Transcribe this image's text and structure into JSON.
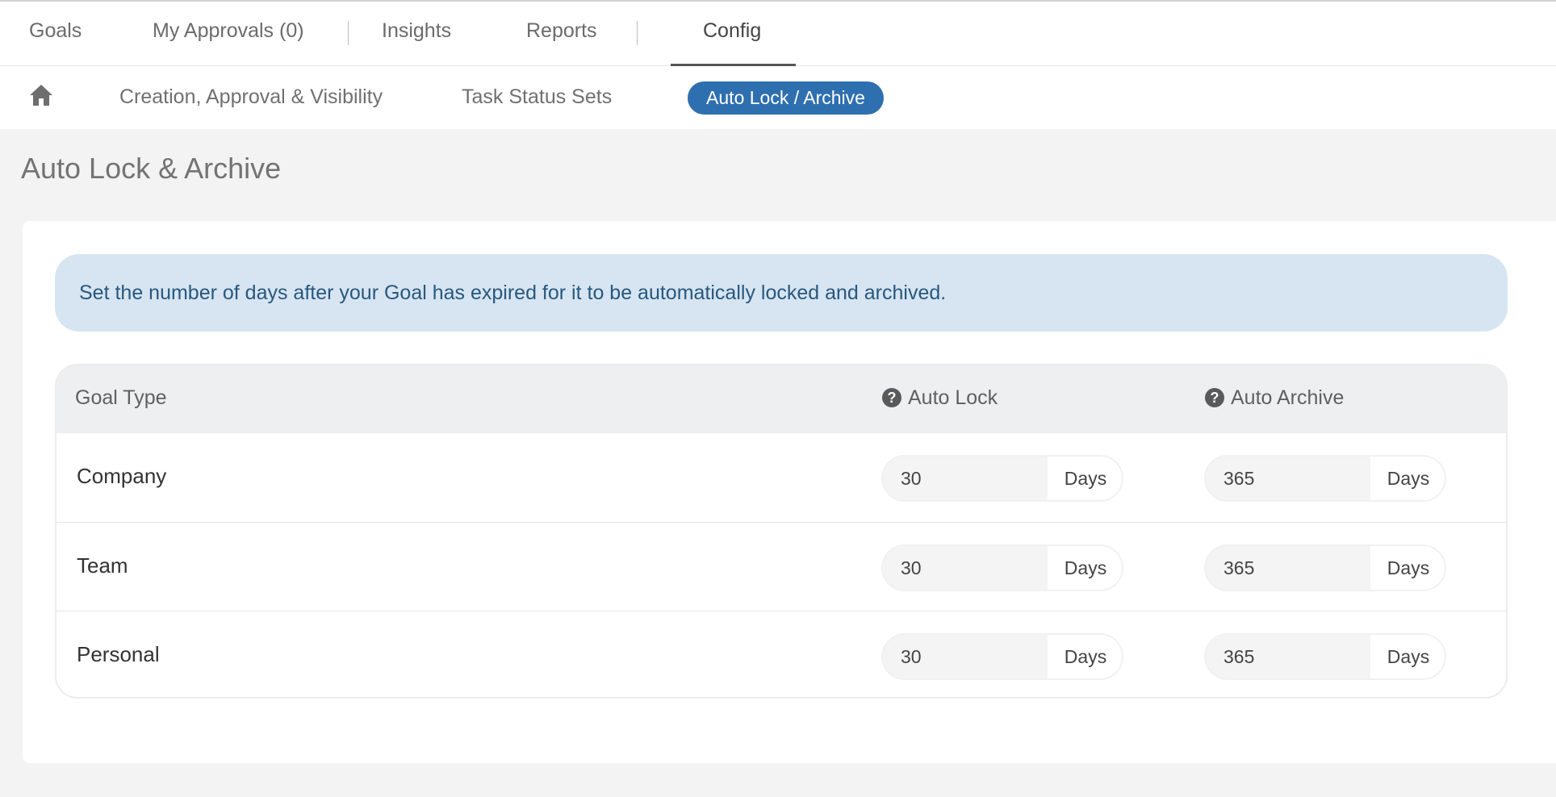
{
  "top_tabs": [
    {
      "label": "Goals"
    },
    {
      "label": "My Approvals (0)"
    },
    {
      "label": "Insights"
    },
    {
      "label": "Reports"
    },
    {
      "label": "Config"
    }
  ],
  "active_top_tab": "Config",
  "sub_nav": {
    "home_icon": "home-icon",
    "links": [
      {
        "label": "Creation, Approval & Visibility"
      },
      {
        "label": "Task Status Sets"
      }
    ],
    "active_pill": "Auto Lock / Archive"
  },
  "page_title": "Auto Lock & Archive",
  "info_message": "Set the number of days after your Goal has expired for it to be automatically locked and archived.",
  "table": {
    "headers": {
      "goal_type": "Goal Type",
      "auto_lock": "Auto Lock",
      "auto_archive": "Auto Archive",
      "help_icon": "question-circle-icon"
    },
    "rows": [
      {
        "type": "Company",
        "lock": "30",
        "lock_unit": "Days",
        "archive": "365",
        "archive_unit": "Days"
      },
      {
        "type": "Team",
        "lock": "30",
        "lock_unit": "Days",
        "archive": "365",
        "archive_unit": "Days"
      },
      {
        "type": "Personal",
        "lock": "30",
        "lock_unit": "Days",
        "archive": "365",
        "archive_unit": "Days"
      }
    ]
  },
  "colors": {
    "accent": "#2e6fb0",
    "info_bg": "#d6e5f1",
    "info_text": "#29577f",
    "page_bg": "#f3f3f3"
  }
}
